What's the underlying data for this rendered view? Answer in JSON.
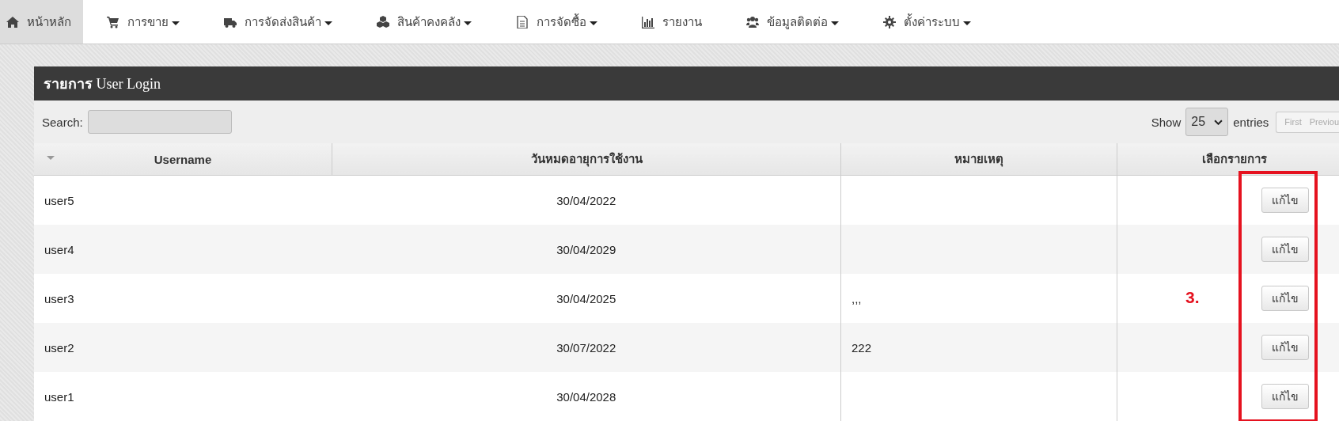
{
  "nav": [
    {
      "label": "หน้าหลัก",
      "dropdown": false,
      "selected": true
    },
    {
      "label": "การขาย",
      "dropdown": true,
      "selected": false
    },
    {
      "label": "การจัดส่งสินค้า",
      "dropdown": true,
      "selected": false
    },
    {
      "label": "สินค้าคงคลัง",
      "dropdown": true,
      "selected": false
    },
    {
      "label": "การจัดซื้อ",
      "dropdown": true,
      "selected": false
    },
    {
      "label": "รายงาน",
      "dropdown": false,
      "selected": false
    },
    {
      "label": "ข้อมูลติดต่อ",
      "dropdown": true,
      "selected": false
    },
    {
      "label": "ตั้งค่าระบบ",
      "dropdown": true,
      "selected": false
    }
  ],
  "panel": {
    "title": "**รายการ** User Login",
    "search": {
      "label": "Search:"
    },
    "length": {
      "before": "Show",
      "value": "25",
      "after": "entries"
    },
    "pagination": [
      "First",
      "Previou"
    ],
    "table": {
      "columns": [
        "Username",
        "วันหมดอายุการใช้งาน",
        "หมายเหตุ",
        "เลือกรายการ"
      ],
      "rows": [
        {
          "username": "user5",
          "expiry": "30/04/2022",
          "note": "",
          "action": "แก้ไข"
        },
        {
          "username": "user4",
          "expiry": "30/04/2029",
          "note": "",
          "action": "แก้ไข"
        },
        {
          "username": "user3",
          "expiry": "30/04/2025",
          "note": ",,,",
          "action": "แก้ไข"
        },
        {
          "username": "user2",
          "expiry": "30/07/2022",
          "note": "222",
          "action": "แก้ไข"
        },
        {
          "username": "user1",
          "expiry": "30/04/2028",
          "note": "",
          "action": "แก้ไข"
        }
      ]
    }
  },
  "annotation": {
    "label": "3."
  }
}
